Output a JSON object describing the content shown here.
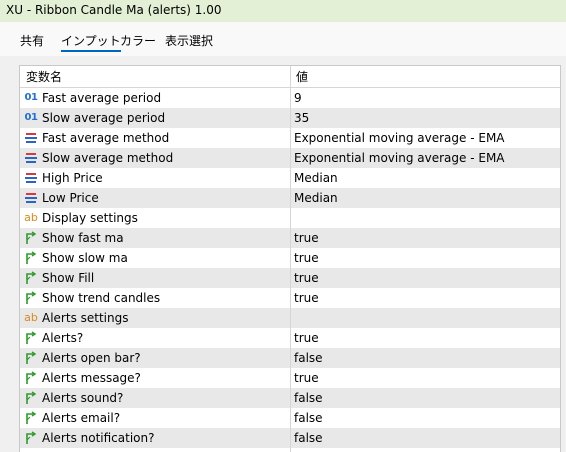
{
  "window": {
    "title": "XU - Ribbon  Candle Ma (alerts) 1.00"
  },
  "tabs": [
    {
      "label": "共有"
    },
    {
      "label": "インプット",
      "active": true
    },
    {
      "label": "カラー"
    },
    {
      "label": "表示選択"
    }
  ],
  "table": {
    "headers": {
      "name": "変数名",
      "value": "値"
    },
    "rows": [
      {
        "icon": "int-icon",
        "glyph": "01",
        "name": "Fast average period",
        "value": "9"
      },
      {
        "icon": "int-icon",
        "glyph": "01",
        "name": "Slow average period",
        "value": "35"
      },
      {
        "icon": "enum-icon",
        "name": "Fast average method",
        "value": "Exponential moving average - EMA"
      },
      {
        "icon": "enum-icon",
        "name": "Slow average method",
        "value": "Exponential moving average - EMA"
      },
      {
        "icon": "enum-icon",
        "name": "High Price",
        "value": "Median"
      },
      {
        "icon": "enum-icon",
        "name": "Low Price",
        "value": "Median"
      },
      {
        "icon": "string-icon",
        "glyph": "ab",
        "name": "Display settings",
        "value": ""
      },
      {
        "icon": "bool-icon",
        "name": "Show fast ma",
        "value": "true"
      },
      {
        "icon": "bool-icon",
        "name": "Show slow ma",
        "value": "true"
      },
      {
        "icon": "bool-icon",
        "name": "Show Fill",
        "value": "true"
      },
      {
        "icon": "bool-icon",
        "name": "Show trend candles",
        "value": "true"
      },
      {
        "icon": "string-icon",
        "glyph": "ab",
        "name": "Alerts settings",
        "value": ""
      },
      {
        "icon": "bool-icon",
        "name": "Alerts?",
        "value": "true"
      },
      {
        "icon": "bool-icon",
        "name": "Alerts open bar?",
        "value": "false"
      },
      {
        "icon": "bool-icon",
        "name": "Alerts message?",
        "value": "true"
      },
      {
        "icon": "bool-icon",
        "name": "Alerts sound?",
        "value": "false"
      },
      {
        "icon": "bool-icon",
        "name": "Alerts email?",
        "value": "false"
      },
      {
        "icon": "bool-icon",
        "name": "Alerts notification?",
        "value": "false"
      }
    ]
  },
  "colors": {
    "title_bg": "#e3f0d6",
    "tab_underline": "#0067c0",
    "alt_row": "#e8e8e8",
    "int_icon": "#1f6fd6",
    "string_icon": "#d88a1a",
    "bool_icon": "#2e9b2e",
    "enum_icon_red": "#d23c3c",
    "enum_icon_blue": "#2a64c4"
  }
}
